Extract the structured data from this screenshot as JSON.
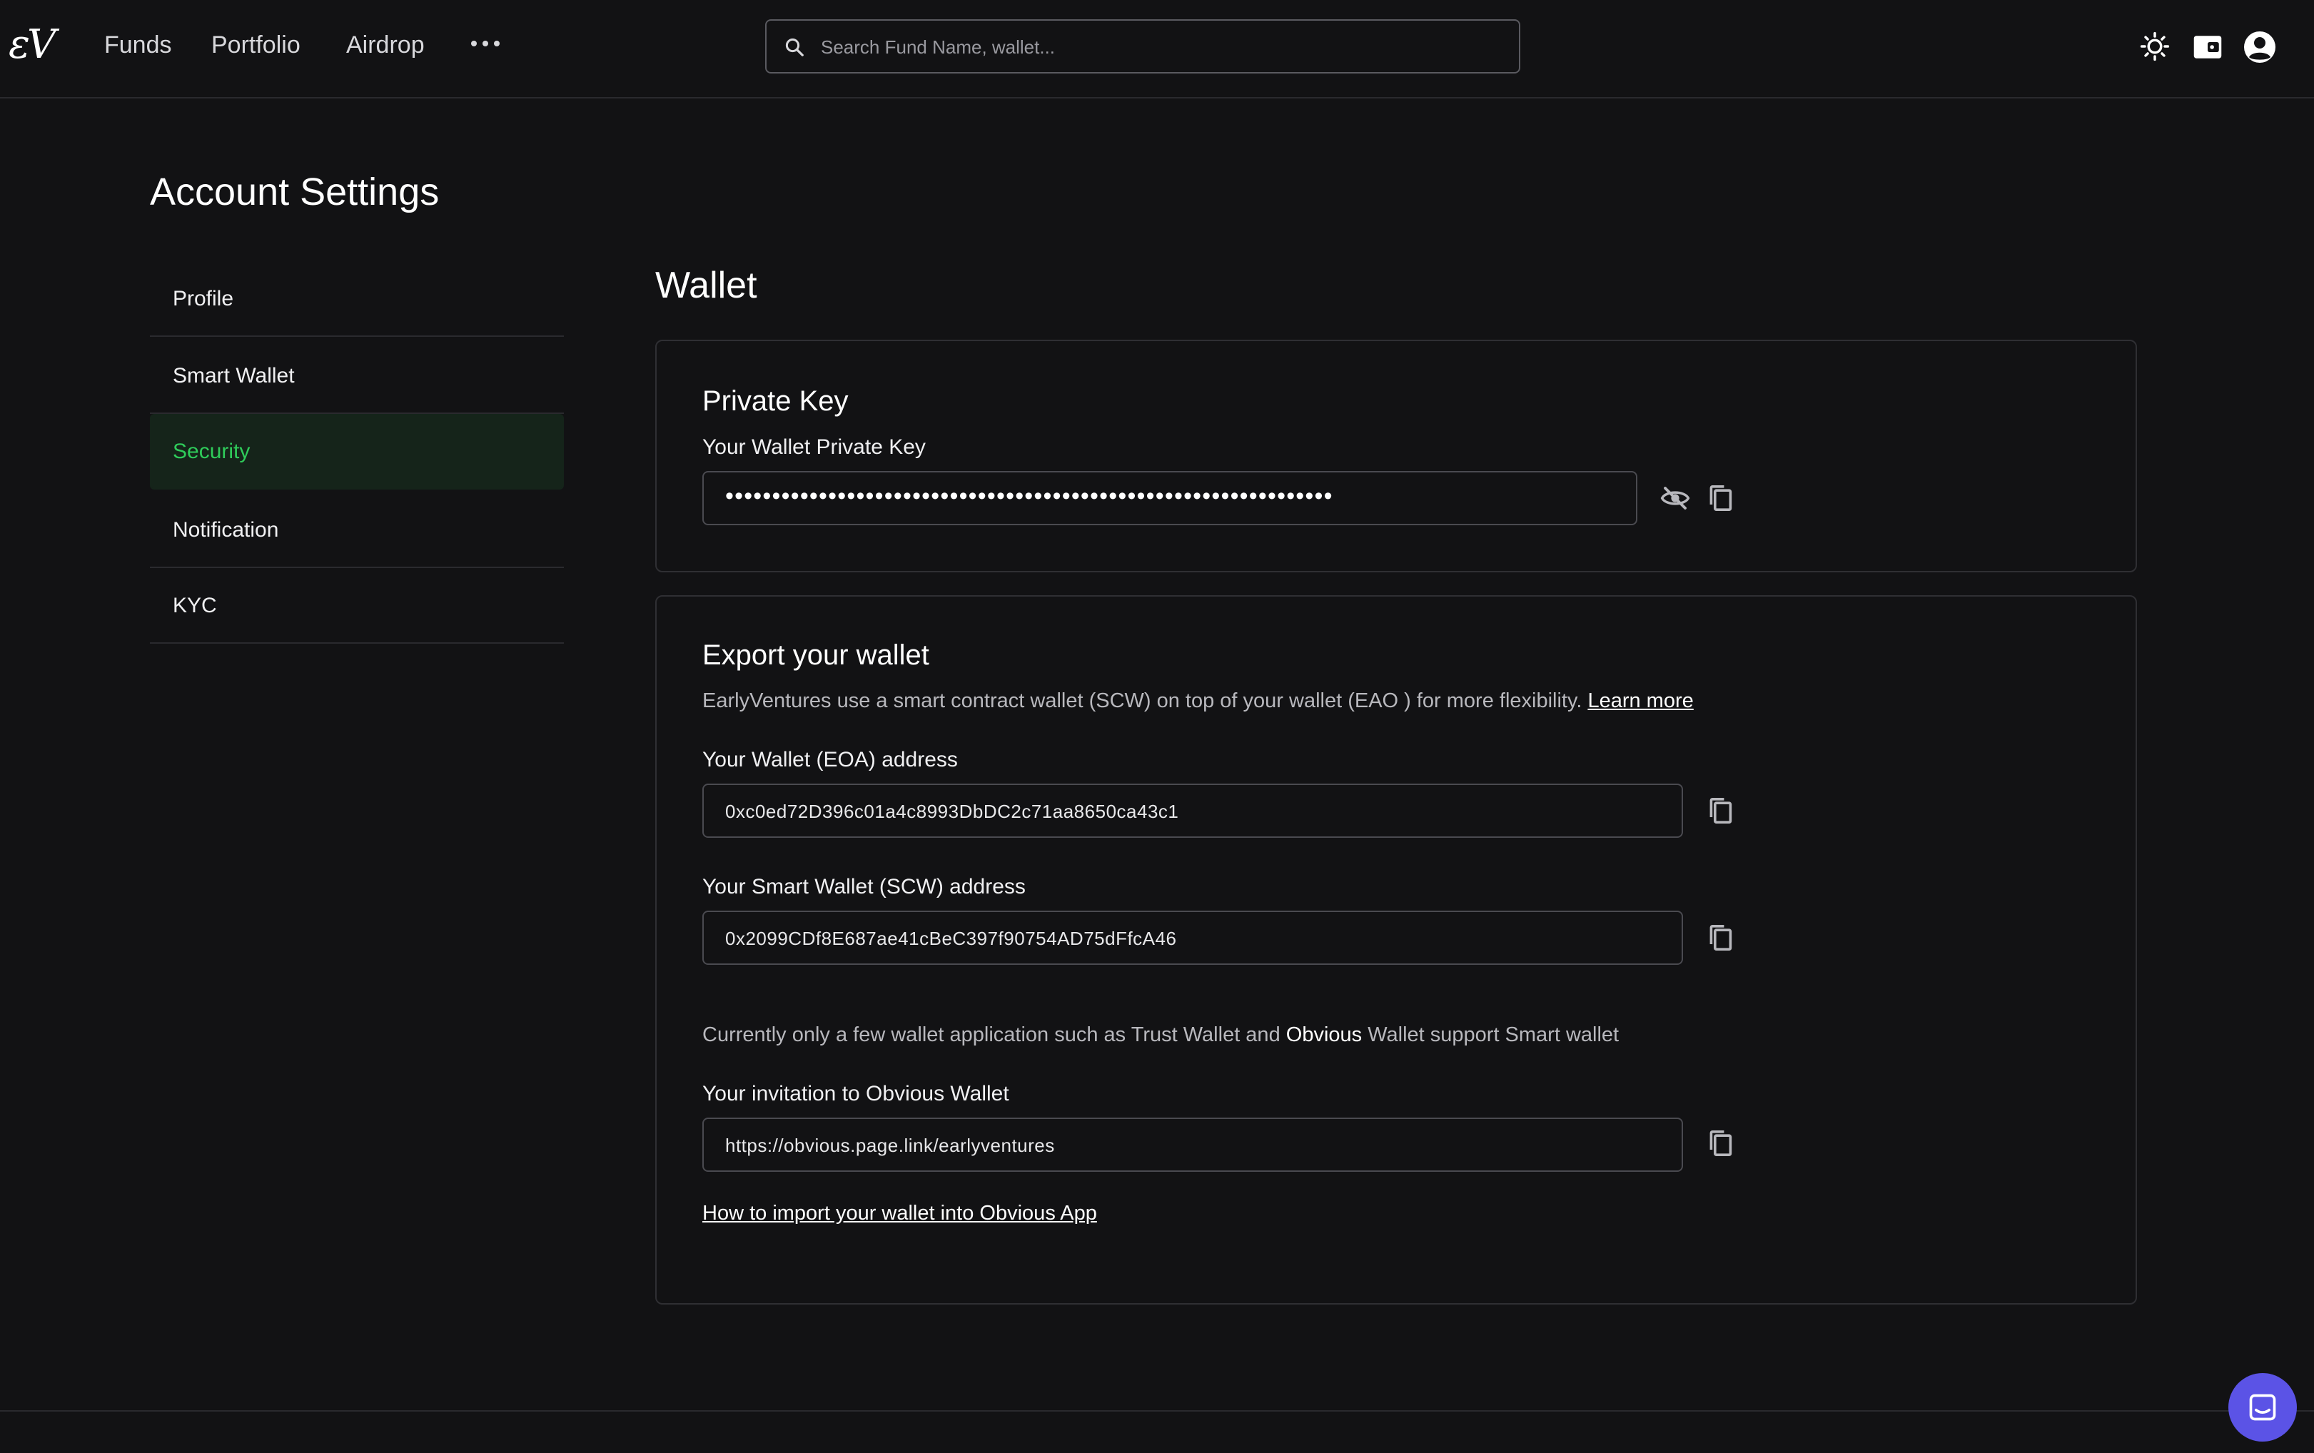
{
  "header": {
    "logo": "εV",
    "nav": [
      "Funds",
      "Portfolio",
      "Airdrop"
    ],
    "more_icon": "more-dots-icon",
    "search_placeholder": "Search Fund Name, wallet...",
    "icons": [
      "sun-icon",
      "wallet-icon",
      "user-avatar-icon"
    ]
  },
  "page": {
    "title": "Account Settings"
  },
  "sidebar": {
    "items": [
      {
        "label": "Profile",
        "active": false
      },
      {
        "label": "Smart Wallet",
        "active": false
      },
      {
        "label": "Security",
        "active": true
      },
      {
        "label": "Notification",
        "active": false
      },
      {
        "label": "KYC",
        "active": false
      }
    ]
  },
  "wallet": {
    "title": "Wallet",
    "private_key": {
      "title": "Private Key",
      "label": "Your Wallet Private Key",
      "masked_value": "•••••••••••••••••••••••••••••••••••••••••••••••••••••••••••••••••"
    },
    "export": {
      "title": "Export your wallet",
      "description": "EarlyVentures use a smart contract wallet (SCW) on top of your wallet (EAO ) for more flexibility.",
      "learn_more": "Learn more",
      "eoa_label": "Your Wallet (EOA) address",
      "eoa_value": "0xc0ed72D396c01a4c8993DbDC2c71aa8650ca43c1",
      "scw_label": "Your Smart Wallet (SCW) address",
      "scw_value": "0x2099CDf8E687ae41cBeC397f90754AD75dFfcA46",
      "note_prefix": "Currently only a few wallet application such as Trust Wallet and",
      "note_highlight": "Obvious",
      "note_suffix": "Wallet support Smart wallet",
      "invite_label": "Your invitation to Obvious Wallet",
      "invite_value": "https://obvious.page.link/earlyventures",
      "howto_link": "How to import your wallet into Obvious App"
    }
  },
  "colors": {
    "background": "#121214",
    "accent_green": "#2fcb5a",
    "active_bg": "#15241a",
    "chat_button": "#5b53e6"
  }
}
